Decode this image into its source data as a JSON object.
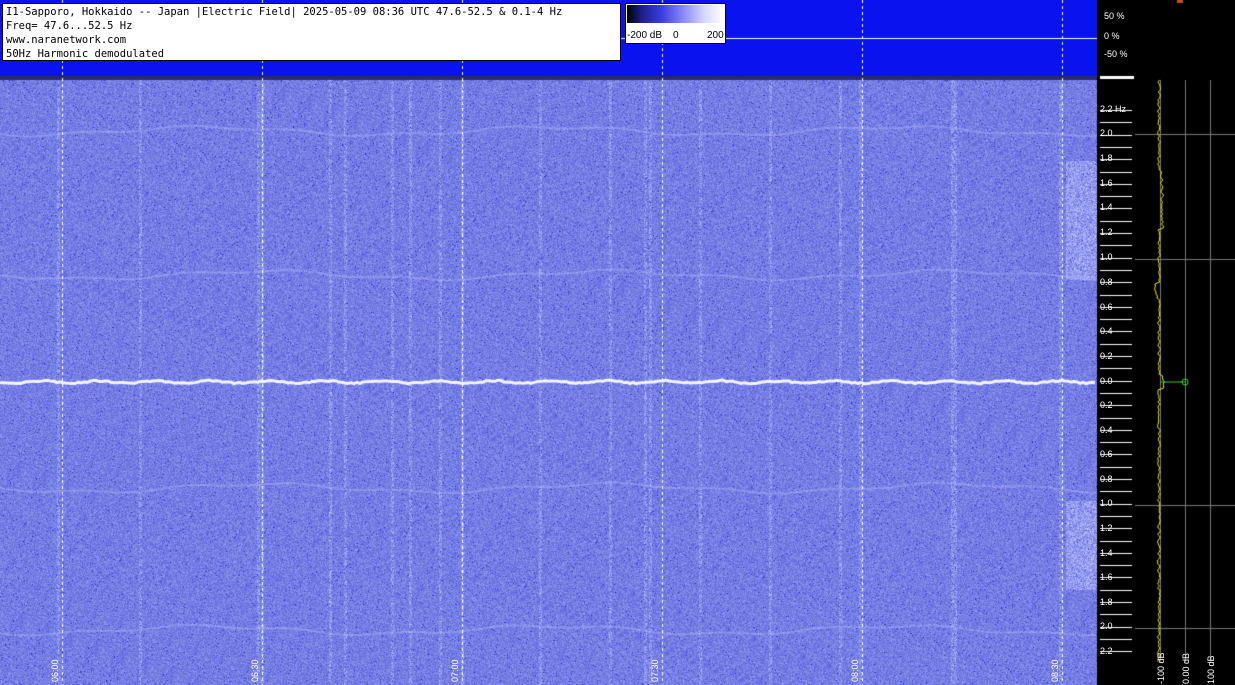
{
  "info": {
    "line1": "I1-Sapporo, Hokkaido -- Japan |Electric Field| 2025-05-09 08:36 UTC 47.6-52.5 & 0.1-4 Hz",
    "line2": "Freq= 47.6...52.5 Hz",
    "line3": "www.naranetwork.com",
    "line4": "50Hz Harmonic demodulated"
  },
  "colorbar": {
    "min_label": "-200 dB",
    "mid_label": "0",
    "max_label": "200"
  },
  "percent_axis": [
    "50 %",
    "0 %",
    "-50 %"
  ],
  "freq_axis": {
    "unit_label": "2.2 Hz",
    "upper_ticks": [
      "2.0",
      "1.8",
      "1.6",
      "1.4",
      "1.2",
      "1.0",
      "0.8",
      "0.6",
      "0.4",
      "0.2",
      "0.0"
    ],
    "lower_ticks": [
      "0.2",
      "0.4",
      "0.6",
      "0.8",
      "1.0",
      "1.2",
      "1.4",
      "1.6",
      "1.8",
      "2.0",
      "2.2"
    ]
  },
  "time_axis": [
    "06:00",
    "06:30",
    "07:00",
    "07:30",
    "08:00",
    "08:30"
  ],
  "side_axis": [
    "-100 dB",
    "0.00 dB",
    "100 dB"
  ],
  "colors": {
    "band": "#0a12f0",
    "spectrogram": "#4a52e6",
    "trace": "#e6e600",
    "marker": "#3ccb3c"
  }
}
